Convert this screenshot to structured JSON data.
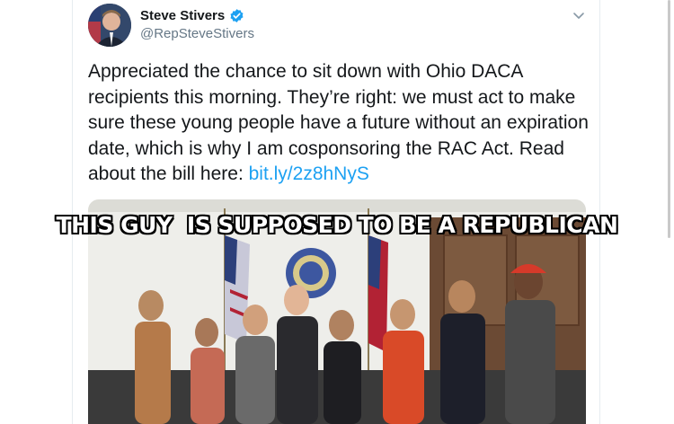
{
  "tweet": {
    "author": {
      "name": "Steve Stivers",
      "handle": "@RepSteveStivers"
    },
    "text_before_link": "Appreciated the chance to sit down with Ohio DACA recipients this morning. They’re right: we must act to make sure these young people have a future without an expiration date, which is why I am cosponsoring the RAC Act. Read about the bill here: ",
    "link_text": "bit.ly/2z8hNyS"
  },
  "meme": {
    "caption": "THIS GUY  IS SUPPOSED TO BE A REPUBLICAN"
  },
  "icons": {
    "verified": "verified-badge-icon",
    "menu": "chevron-down-icon"
  },
  "colors": {
    "link": "#1da1f2",
    "verified": "#1da1f2",
    "handle": "#657786",
    "text": "#14171a"
  }
}
